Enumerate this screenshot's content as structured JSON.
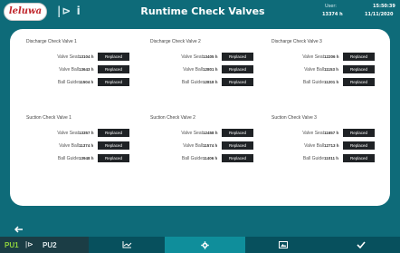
{
  "header": {
    "logo_text": "leluwa",
    "pump_info": "|⊳ i",
    "title": "Runtime Check Valves",
    "user_label": "User:",
    "user_value": "13374 h",
    "time": "15:50:39",
    "date": "11/11/2020"
  },
  "groups": [
    {
      "title": "Discharge Check Valve 1",
      "rows": [
        {
          "label": "Valve Seat",
          "value": "13104 h",
          "button": "Replaced"
        },
        {
          "label": "Valve Ball",
          "value": "13643 h",
          "button": "Replaced"
        },
        {
          "label": "Ball Guide",
          "value": "11504 h",
          "button": "Replaced"
        }
      ]
    },
    {
      "title": "Discharge Check Valve 2",
      "rows": [
        {
          "label": "Valve Seat",
          "value": "13405 h",
          "button": "Replaced"
        },
        {
          "label": "Valve Ball",
          "value": "12801 h",
          "button": "Replaced"
        },
        {
          "label": "Ball Guide",
          "value": "12818 h",
          "button": "Replaced"
        }
      ]
    },
    {
      "title": "Discharge Check Valve 3",
      "rows": [
        {
          "label": "Valve Seat",
          "value": "12206 h",
          "button": "Replaced"
        },
        {
          "label": "Valve Ball",
          "value": "11153 h",
          "button": "Replaced"
        },
        {
          "label": "Ball Guide",
          "value": "11201 h",
          "button": "Replaced"
        }
      ]
    },
    {
      "title": "Suction Check Valve 1",
      "rows": [
        {
          "label": "Valve Seat",
          "value": "13357 h",
          "button": "Replaced"
        },
        {
          "label": "Valve Ball",
          "value": "11374 h",
          "button": "Replaced"
        },
        {
          "label": "Ball Guide",
          "value": "13948 h",
          "button": "Replaced"
        }
      ]
    },
    {
      "title": "Suction Check Valve 2",
      "rows": [
        {
          "label": "Valve Seat",
          "value": "12458 h",
          "button": "Replaced"
        },
        {
          "label": "Valve Ball",
          "value": "11574 h",
          "button": "Replaced"
        },
        {
          "label": "Ball Guide",
          "value": "11406 h",
          "button": "Replaced"
        }
      ]
    },
    {
      "title": "Suction Check Valve 3",
      "rows": [
        {
          "label": "Valve Seat",
          "value": "11657 h",
          "button": "Replaced"
        },
        {
          "label": "Valve Ball",
          "value": "12713 h",
          "button": "Replaced"
        },
        {
          "label": "Ball Guide",
          "value": "11011 h",
          "button": "Replaced"
        }
      ]
    }
  ],
  "footer": {
    "back_icon": "arrow-left-icon",
    "pu1": "PU1",
    "pu_arrow": "|⊳",
    "pu2": "PU2",
    "chart_icon": "line-chart-icon",
    "settings_icon": "gear-icon",
    "image_icon": "image-icon",
    "ok_icon": "checkmark-icon",
    "active_color": "#8fd33d"
  }
}
